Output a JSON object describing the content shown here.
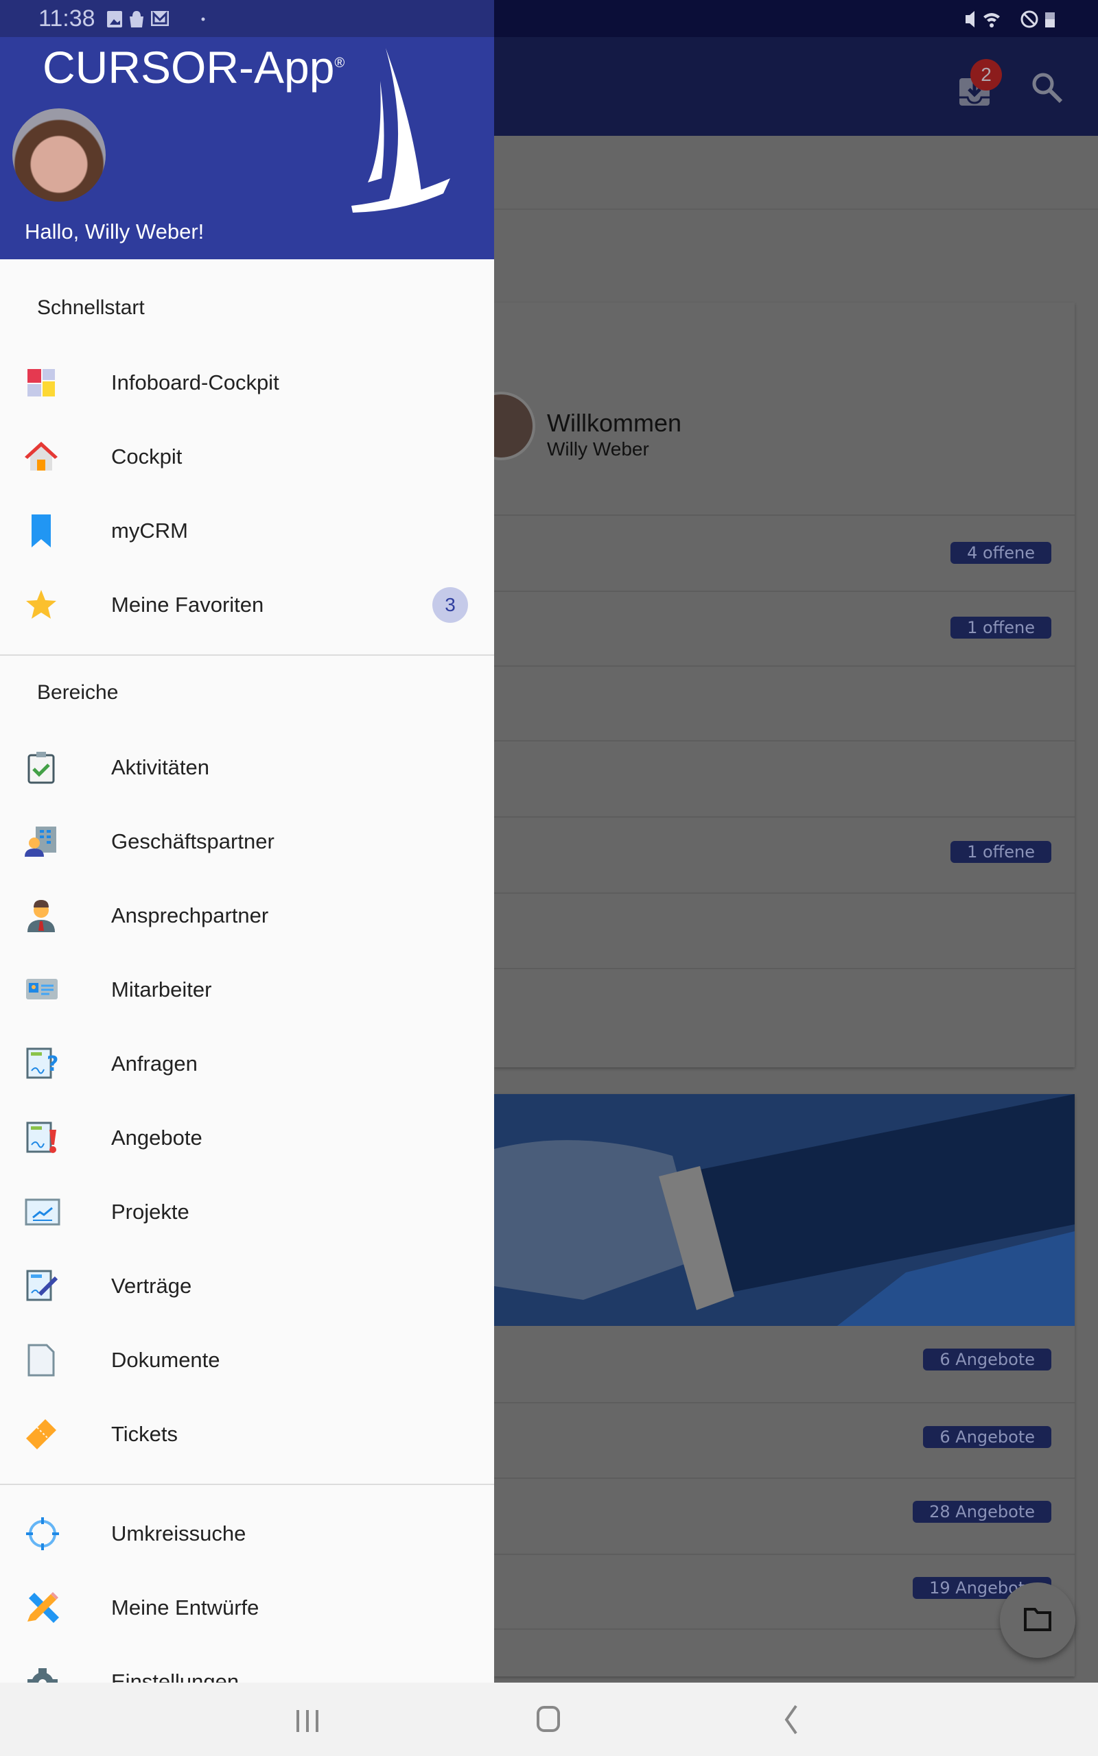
{
  "status_bar": {
    "time": "11:38",
    "icons": [
      "image-icon",
      "shopping-bag-icon",
      "mail-icon",
      "mute-icon",
      "wifi-icon",
      "do-not-disturb-icon",
      "battery-icon"
    ]
  },
  "app_bar": {
    "inbox_badge": "2",
    "icons": [
      "inbox-download-icon",
      "search-icon"
    ]
  },
  "drawer": {
    "title": "CURSOR-App",
    "registered": "®",
    "greeting": "Hallo, Willy Weber!",
    "sections": [
      {
        "title": "Schnellstart",
        "items": [
          {
            "label": "Infoboard-Cockpit",
            "icon": "dashboard-icon"
          },
          {
            "label": "Cockpit",
            "icon": "house-icon"
          },
          {
            "label": "myCRM",
            "icon": "bookmark-icon"
          },
          {
            "label": "Meine Favoriten",
            "icon": "star-icon",
            "badge": "3"
          }
        ]
      },
      {
        "title": "Bereiche",
        "items": [
          {
            "label": "Aktivitäten",
            "icon": "clipboard-check-icon"
          },
          {
            "label": "Geschäftspartner",
            "icon": "business-partner-icon"
          },
          {
            "label": "Ansprechpartner",
            "icon": "contact-person-icon"
          },
          {
            "label": "Mitarbeiter",
            "icon": "employee-card-icon"
          },
          {
            "label": "Anfragen",
            "icon": "inquiry-document-icon"
          },
          {
            "label": "Angebote",
            "icon": "offer-document-icon"
          },
          {
            "label": "Projekte",
            "icon": "project-chart-icon"
          },
          {
            "label": "Verträge",
            "icon": "contract-pen-icon"
          },
          {
            "label": "Dokumente",
            "icon": "document-icon"
          },
          {
            "label": "Tickets",
            "icon": "ticket-icon"
          }
        ]
      },
      {
        "title": "",
        "items": [
          {
            "label": "Umkreissuche",
            "icon": "crosshair-icon"
          },
          {
            "label": "Meine Entwürfe",
            "icon": "ruler-pencil-icon"
          },
          {
            "label": "Einstellungen",
            "icon": "gear-icon"
          }
        ]
      }
    ]
  },
  "main": {
    "welcome": {
      "title": "Willkommen",
      "name": "Willy Weber"
    },
    "upper_badges": [
      "4 offene",
      "1 offene",
      "",
      "",
      "1 offene",
      "",
      ""
    ],
    "lower_badges": [
      "6 Angebote",
      "6 Angebote",
      "28 Angebote",
      "19 Angebote"
    ]
  },
  "colors": {
    "drawer_header": "#2f3c9c",
    "app_bar": "#141a45",
    "badge": "#1a2352",
    "favorites_badge": "#c5cae9"
  }
}
